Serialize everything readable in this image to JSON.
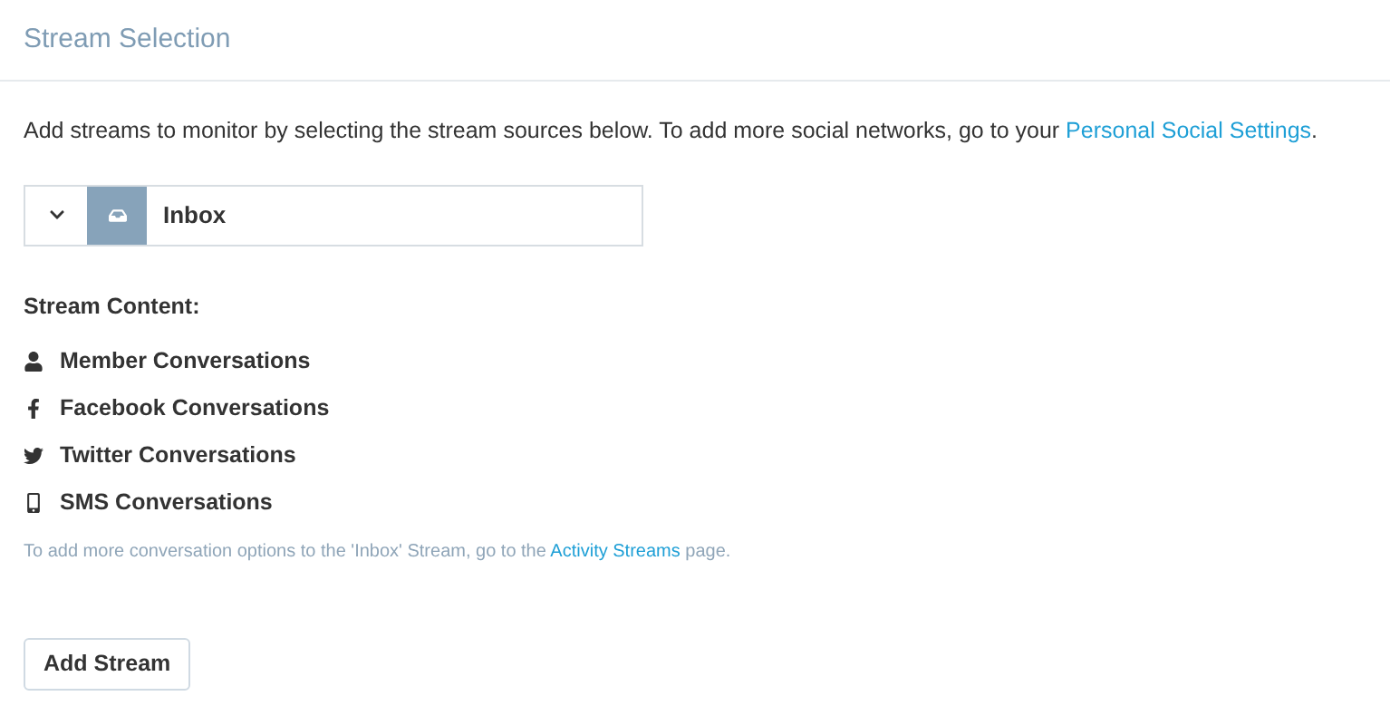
{
  "header": {
    "title": "Stream Selection"
  },
  "intro": {
    "text": "Add streams to monitor by selecting the stream sources below. To add more social networks, go to your ",
    "link": "Personal Social Settings",
    "after": "."
  },
  "stream_select": {
    "value": "Inbox"
  },
  "content": {
    "heading": "Stream Content:",
    "items": [
      {
        "kind": "member",
        "label": "Member Conversations"
      },
      {
        "kind": "facebook",
        "label": "Facebook Conversations"
      },
      {
        "kind": "twitter",
        "label": "Twitter Conversations"
      },
      {
        "kind": "sms",
        "label": "SMS Conversations"
      }
    ]
  },
  "note": {
    "text": "To add more conversation options to the 'Inbox' Stream, go to the ",
    "link": "Activity Streams",
    "after": " page."
  },
  "buttons": [
    "Add Stream"
  ]
}
